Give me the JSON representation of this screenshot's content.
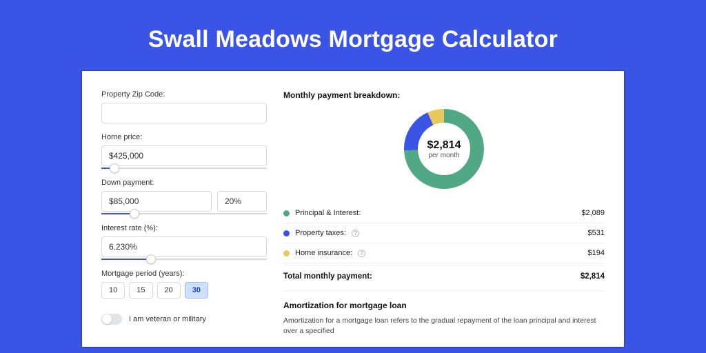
{
  "page": {
    "title": "Swall Meadows Mortgage Calculator"
  },
  "form": {
    "zip": {
      "label": "Property Zip Code:",
      "value": ""
    },
    "home_price": {
      "label": "Home price:",
      "value": "$425,000",
      "slider_pct": 8
    },
    "down_payment": {
      "label": "Down payment:",
      "amount": "$85,000",
      "percent": "20%",
      "slider_pct": 20
    },
    "interest_rate": {
      "label": "Interest rate (%):",
      "value": "6.230%",
      "slider_pct": 30
    },
    "mortgage_period": {
      "label": "Mortgage period (years):",
      "options": [
        "10",
        "15",
        "20",
        "30"
      ],
      "selected": "30"
    },
    "veteran": {
      "label": "I am veteran or military",
      "checked": false
    }
  },
  "breakdown": {
    "title": "Monthly payment breakdown:",
    "center_amount": "$2,814",
    "center_sub": "per month",
    "items": [
      {
        "label": "Principal & Interest:",
        "value": "$2,089",
        "color": "green",
        "info": false
      },
      {
        "label": "Property taxes:",
        "value": "$531",
        "color": "blue",
        "info": true
      },
      {
        "label": "Home insurance:",
        "value": "$194",
        "color": "yellow",
        "info": true
      }
    ],
    "total_label": "Total monthly payment:",
    "total_value": "$2,814"
  },
  "amortization": {
    "title": "Amortization for mortgage loan",
    "text": "Amortization for a mortgage loan refers to the gradual repayment of the loan principal and interest over a specified"
  },
  "chart_data": {
    "type": "pie",
    "title": "Monthly payment breakdown",
    "series": [
      {
        "name": "Principal & Interest",
        "value": 2089,
        "color": "#50a884"
      },
      {
        "name": "Property taxes",
        "value": 531,
        "color": "#3a55e6"
      },
      {
        "name": "Home insurance",
        "value": 194,
        "color": "#e8c95c"
      }
    ],
    "total": 2814,
    "center_label": "$2,814 per month"
  }
}
